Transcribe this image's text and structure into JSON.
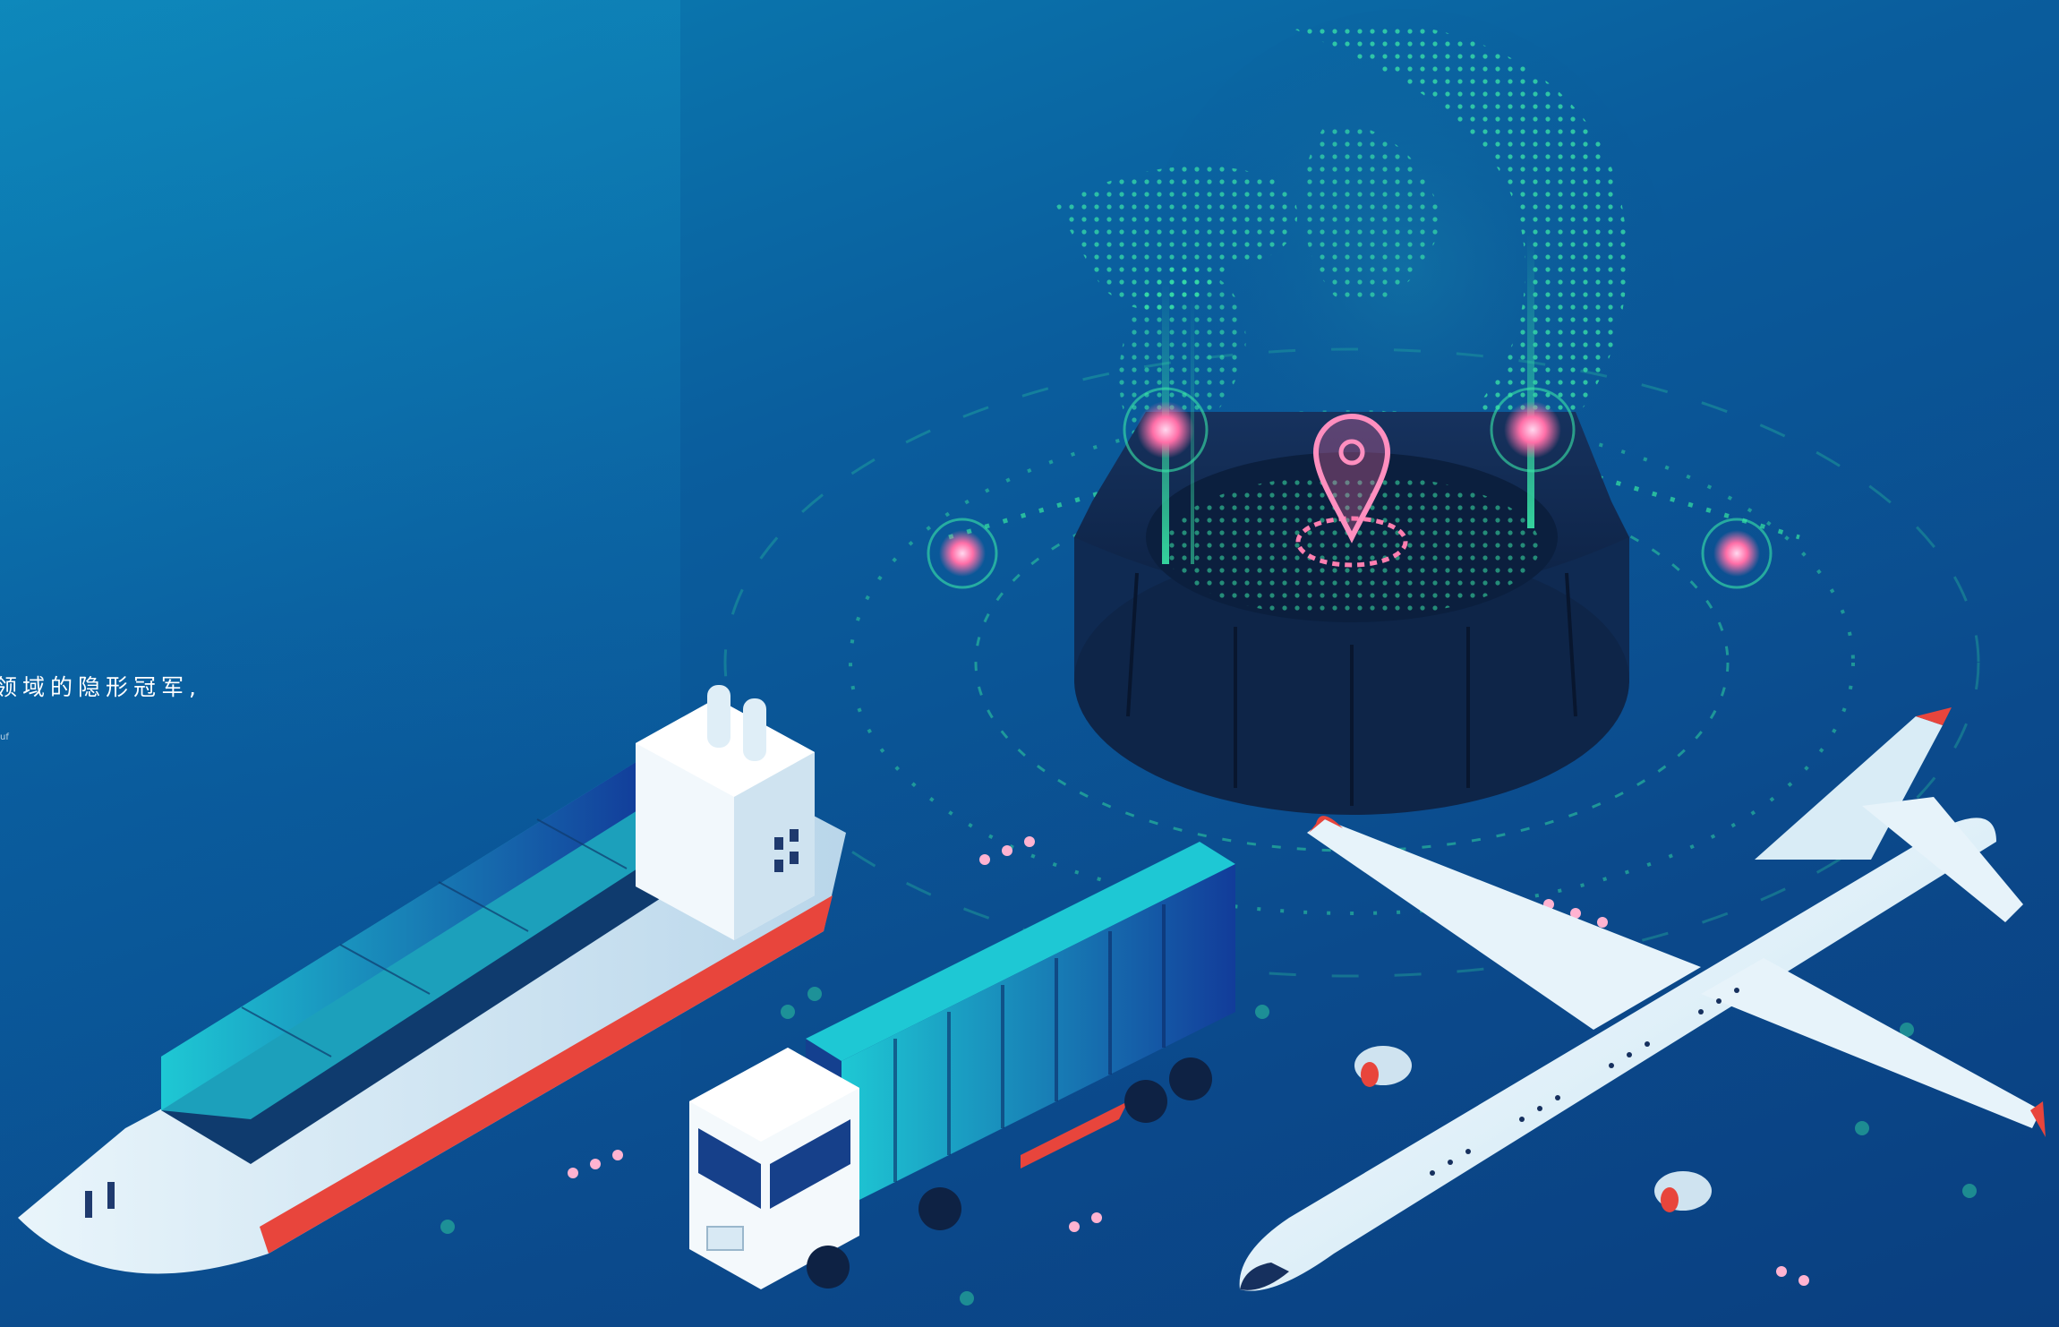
{
  "hero": {
    "headline_fragment": "领域的隐形冠军,",
    "subline_fragment": "uf"
  },
  "illustration": {
    "subjects": [
      "globe-hologram",
      "location-pin",
      "container-ship",
      "container-truck",
      "airplane"
    ],
    "colors": {
      "background_top": "#0a80b4",
      "background_bottom": "#0a3f80",
      "hologram": "#39e6a8",
      "pin": "#ff6fa8",
      "accent_red": "#e8453c"
    }
  }
}
